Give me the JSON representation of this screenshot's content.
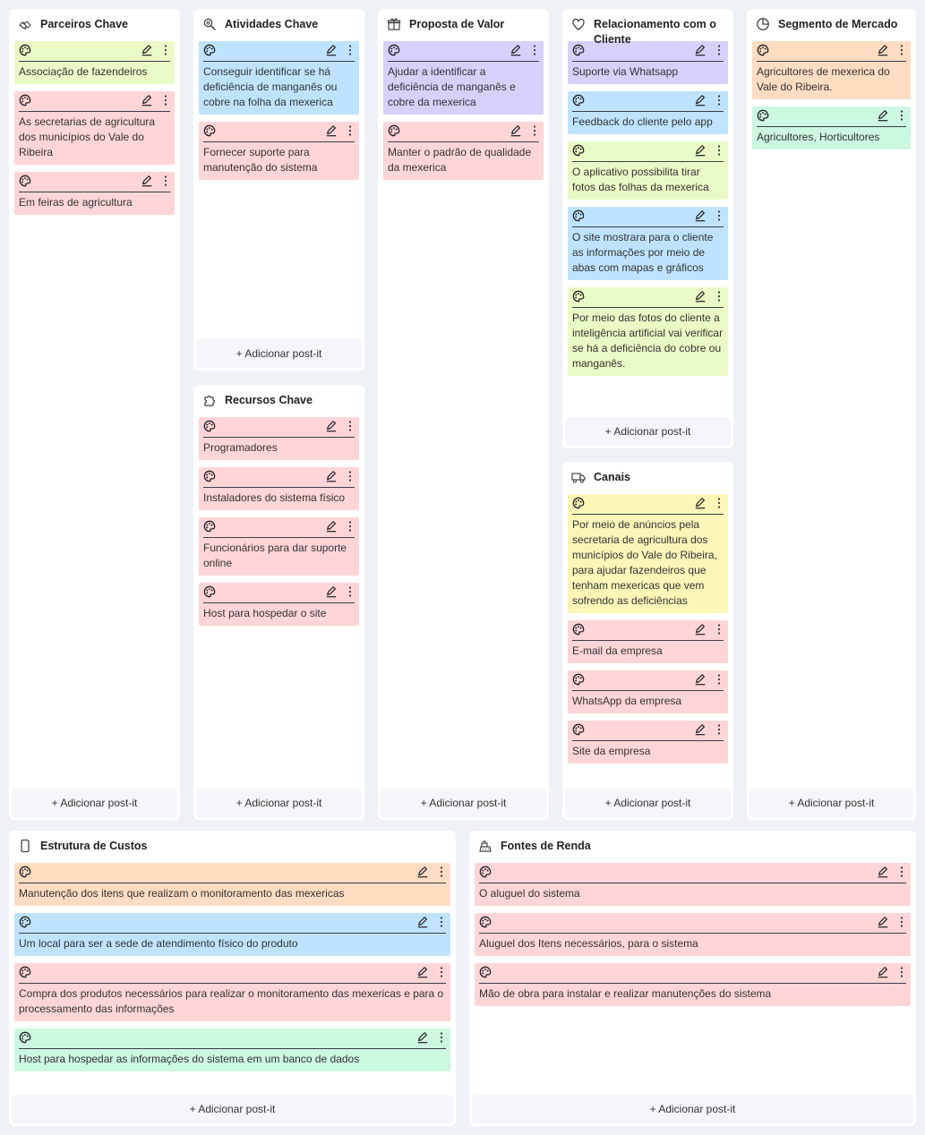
{
  "add_label": "+ Adicionar post-it",
  "colors": {
    "green": "#eafac6",
    "red": "#ffd5d7",
    "blue": "#bfe3ff",
    "purple": "#d8cffb",
    "yellow": "#fbf6b8",
    "orange": "#ffdcc2",
    "mint": "#ccf7e0"
  },
  "blocks": {
    "parceiros": {
      "title": "Parceiros Chave",
      "icon": "handshake-icon",
      "notes": [
        {
          "color": "green",
          "text": "Associação de fazendeiros"
        },
        {
          "color": "red",
          "text": "As secretarias de agricultura dos municípios do Vale do Ribeira"
        },
        {
          "color": "red",
          "text": "Em feiras de agricultura"
        }
      ]
    },
    "atividades": {
      "title": "Atividades Chave",
      "icon": "search-gear-icon",
      "notes": [
        {
          "color": "blue",
          "text": "Conseguir identificar se há deficiência de manganês ou cobre na folha da mexerica"
        },
        {
          "color": "red",
          "text": "Fornecer suporte para manutenção do sistema"
        }
      ]
    },
    "recursos": {
      "title": "Recursos Chave",
      "icon": "puzzle-icon",
      "notes": [
        {
          "color": "red",
          "text": "Programadores"
        },
        {
          "color": "red",
          "text": "Instaladores do sistema físico"
        },
        {
          "color": "red",
          "text": "Funcionários para dar suporte online"
        },
        {
          "color": "red",
          "text": "Host para hospedar o site"
        }
      ]
    },
    "proposta": {
      "title": "Proposta de Valor",
      "icon": "gift-icon",
      "notes": [
        {
          "color": "purple",
          "text": "Ajudar a identificar a deficiência de manganês e cobre da mexerica"
        },
        {
          "color": "red",
          "text": "Manter o padrão de qualidade da mexerica"
        }
      ]
    },
    "relacionamento": {
      "title": "Relacionamento com o Cliente",
      "icon": "heart-icon",
      "notes": [
        {
          "color": "purple",
          "text": "Suporte via Whatsapp"
        },
        {
          "color": "blue",
          "text": "Feedback do cliente pelo app"
        },
        {
          "color": "green",
          "text": "O aplicativo possibilita tirar fotos das folhas da mexerica"
        },
        {
          "color": "blue",
          "text": "O site mostrara para o cliente as informações por meio de abas com mapas e gráficos"
        },
        {
          "color": "green",
          "text": "Por meio das fotos do cliente a inteligência artificial vai verificar se há a deficiência do cobre ou manganês."
        }
      ]
    },
    "canais": {
      "title": "Canais",
      "icon": "truck-icon",
      "notes": [
        {
          "color": "yellow",
          "text": "Por meio de anúncios pela secretaria de agricultura dos municípios do Vale do Ribeira, para ajudar fazendeiros que tenham mexericas que vem sofrendo as deficiências"
        },
        {
          "color": "red",
          "text": "E-mail da empresa"
        },
        {
          "color": "red",
          "text": "WhatsApp da empresa"
        },
        {
          "color": "red",
          "text": "Site da empresa"
        }
      ]
    },
    "segmento": {
      "title": "Segmento de Mercado",
      "icon": "pie-chart-icon",
      "notes": [
        {
          "color": "orange",
          "text": "Agricultores de mexerica do Vale do Ribeira."
        },
        {
          "color": "mint",
          "text": "Agricultores, Horticultores"
        }
      ]
    },
    "custos": {
      "title": "Estrutura de Custos",
      "icon": "phone-icon",
      "notes": [
        {
          "color": "orange",
          "text": "Manutenção dos itens que realizam o monitoramento das mexericas"
        },
        {
          "color": "blue",
          "text": "Um local para ser a sede de atendimento físico do produto"
        },
        {
          "color": "red",
          "text": "Compra dos produtos necessários para realizar o monitoramento das mexericas e para o processamento das informações"
        },
        {
          "color": "mint",
          "text": "Host para hospedar as informações do sistema em um banco de dados"
        }
      ]
    },
    "fontes": {
      "title": "Fontes de Renda",
      "icon": "cash-register-icon",
      "notes": [
        {
          "color": "red",
          "text": "O aluguel do sistema"
        },
        {
          "color": "red",
          "text": "Aluguel dos Itens necessários, para o sistema"
        },
        {
          "color": "red",
          "text": "Mão de obra para instalar e realizar manutenções do sistema"
        }
      ]
    }
  }
}
